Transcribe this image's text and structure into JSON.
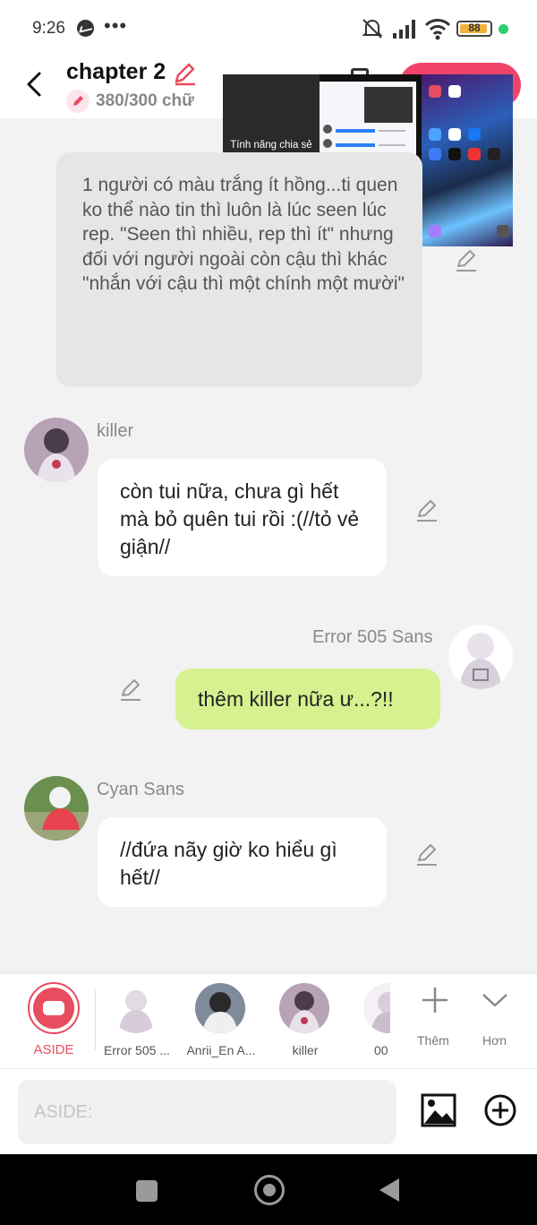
{
  "status_bar": {
    "time": "9:26",
    "more": "•••",
    "battery": "88"
  },
  "header": {
    "title": "chapter 2",
    "word_count": "380/300 chữ"
  },
  "screen_share": {
    "notice": "Tính năng chia sẻ màn hình đang bật"
  },
  "messages": [
    {
      "type": "aside",
      "text": "1 người có màu trắng ít hồng...ti quen ko thể nào tin thì luôn là lúc seen lúc rep. \"Seen thì nhiều, rep thì ít\" nhưng đối với người ngoài còn cậu thì khác \"nhắn với cậu thì một chính một mười\""
    },
    {
      "type": "incoming",
      "sender": "killer",
      "text": "còn tui nữa, chưa gì hết mà bỏ quên tui rồi :(//tỏ vẻ giận//"
    },
    {
      "type": "outgoing",
      "sender": "Error 505 Sans",
      "text": "thêm killer nữa ư...?!!"
    },
    {
      "type": "incoming",
      "sender": "Cyan Sans",
      "text": "//đứa nãy giờ ko hiểu gì hết//"
    }
  ],
  "character_bar": {
    "aside_label": "ASIDE",
    "characters": [
      {
        "label": "Error 505 ..."
      },
      {
        "label": "Anrii_En A..."
      },
      {
        "label": "killer"
      },
      {
        "label": "00"
      }
    ],
    "add_label": "Thêm",
    "more_label": "Hơn"
  },
  "composer": {
    "placeholder": "ASIDE:"
  },
  "colors": {
    "accent": "#f0446a",
    "aside_red": "#e84c5f",
    "outgoing_bubble": "#d5f190",
    "aside_bubble": "#e6e6e6"
  }
}
